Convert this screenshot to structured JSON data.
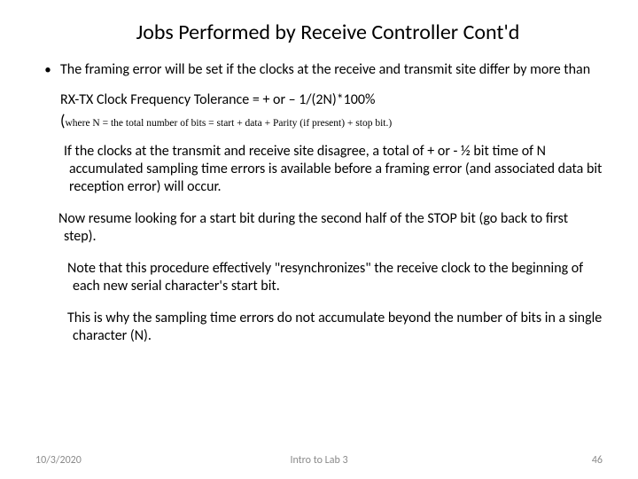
{
  "title": "Jobs Performed by Receive Controller Cont'd",
  "bullet": {
    "dot": "•",
    "text": "The framing error will be set if the clocks at the receive and transmit site differ by more than"
  },
  "formula": "RX-TX Clock Frequency Tolerance = + or – 1/(2N)*100%",
  "subnote_open": "(",
  "subnote": "where N = the total number of bits = start + data + Parity (if present) + stop bit.)",
  "para1": "If the clocks at the transmit and receive site disagree, a total of + or - ½ bit time of N accumulated sampling time errors is available before a framing error (and associated data bit reception error) will occur.",
  "para2": "Now resume looking for a start bit during the second half of the STOP bit (go back to first step).",
  "para3": "Note that this procedure effectively \"resynchronizes\" the receive clock to the beginning of each new serial character's start bit.",
  "para4": "This is why the sampling time errors do not accumulate beyond the number of bits in a single character (N).",
  "footer": {
    "date": "10/3/2020",
    "center": "Intro to Lab 3",
    "page": "46"
  }
}
